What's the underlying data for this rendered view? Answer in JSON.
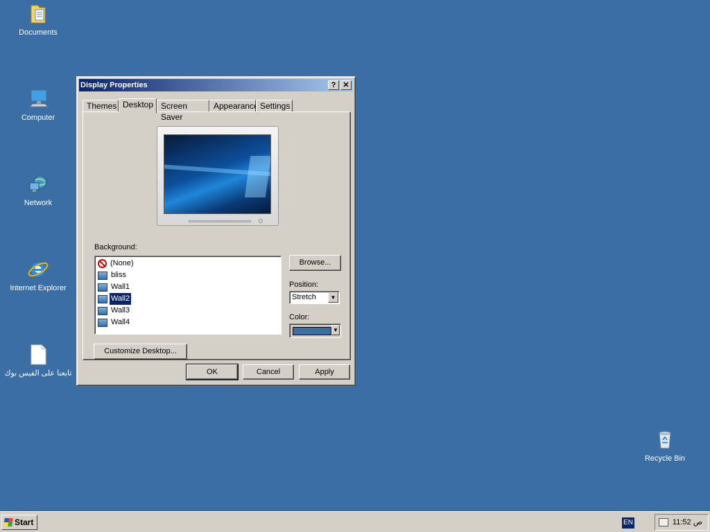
{
  "desktop": {
    "icons": [
      {
        "label": "Documents",
        "icon": "folder-documents-icon"
      },
      {
        "label": "Computer",
        "icon": "computer-icon"
      },
      {
        "label": "Network",
        "icon": "network-globe-icon"
      },
      {
        "label": "Internet Explorer",
        "icon": "internet-explorer-icon"
      },
      {
        "label": "تابعنا على الفيس بوك",
        "icon": "text-document-icon"
      },
      {
        "label": "Recycle Bin",
        "icon": "recycle-bin-icon"
      }
    ],
    "background_color": "#3a6ea5"
  },
  "window": {
    "title": "Display Properties",
    "help_label": "?",
    "close_label": "✕",
    "tabs": [
      {
        "label": "Themes"
      },
      {
        "label": "Desktop",
        "active": true
      },
      {
        "label": "Screen Saver"
      },
      {
        "label": "Appearance"
      },
      {
        "label": "Settings"
      }
    ],
    "background_label": "Background:",
    "backgrounds": [
      {
        "label": "(None)",
        "icon": "none-icon"
      },
      {
        "label": "bliss",
        "icon": "picture-icon"
      },
      {
        "label": "Wall1",
        "icon": "picture-icon"
      },
      {
        "label": "Wall2",
        "icon": "picture-icon",
        "selected": true
      },
      {
        "label": "Wall3",
        "icon": "picture-icon"
      },
      {
        "label": "Wall4",
        "icon": "picture-icon"
      }
    ],
    "browse_label": "Browse...",
    "position_label": "Position:",
    "position_value": "Stretch",
    "color_label": "Color:",
    "color_value": "#3a6ea5",
    "customize_label": "Customize Desktop...",
    "ok_label": "OK",
    "cancel_label": "Cancel",
    "apply_label": "Apply"
  },
  "taskbar": {
    "start_label": "Start",
    "language": "EN",
    "clock": "11:52 ص"
  }
}
